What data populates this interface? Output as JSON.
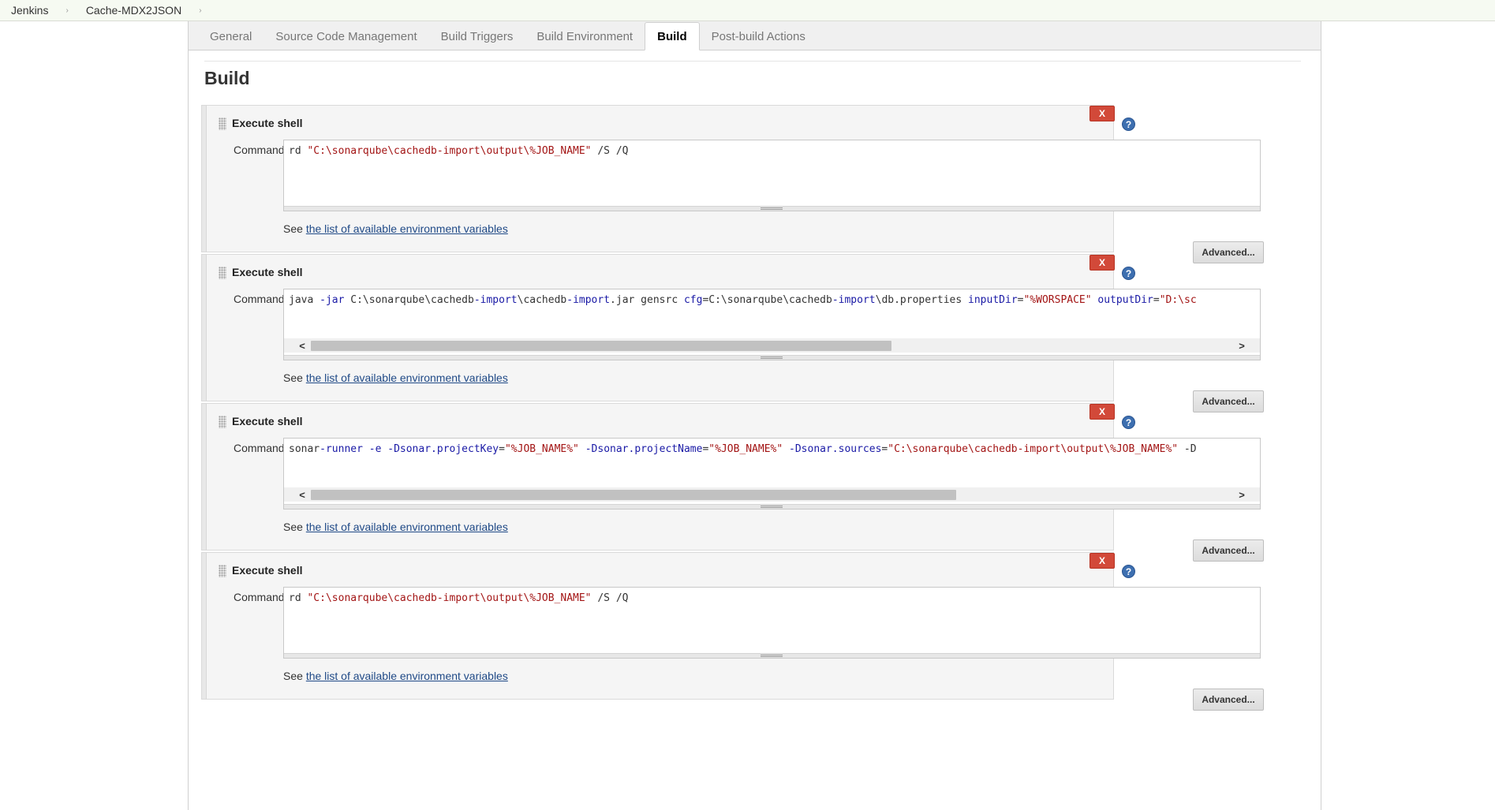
{
  "breadcrumb": {
    "items": [
      "Jenkins",
      "Cache-MDX2JSON"
    ],
    "separator": "›"
  },
  "tabs": [
    {
      "label": "General",
      "active": false
    },
    {
      "label": "Source Code Management",
      "active": false
    },
    {
      "label": "Build Triggers",
      "active": false
    },
    {
      "label": "Build Environment",
      "active": false
    },
    {
      "label": "Build",
      "active": true
    },
    {
      "label": "Post-build Actions",
      "active": false
    }
  ],
  "section_title": "Build",
  "steps": [
    {
      "title": "Execute shell",
      "command_label": "Command",
      "command": "rd \"C:\\sonarqube\\cachedb-import\\output\\%JOB_NAME\" /S /Q",
      "see_prefix": "See ",
      "env_link": "the list of available environment variables",
      "delete_label": "X",
      "help_label": "?",
      "advanced_label": "Advanced...",
      "hscroll_fraction": 0
    },
    {
      "title": "Execute shell",
      "command_label": "Command",
      "command": "java -jar C:\\sonarqube\\cachedb-import\\cachedb-import.jar gensrc cfg=C:\\sonarqube\\cachedb-import\\db.properties inputDir=\"%WORSPACE\" outputDir=\"D:\\sc",
      "see_prefix": "See ",
      "env_link": "the list of available environment variables",
      "delete_label": "X",
      "help_label": "?",
      "advanced_label": "Advanced...",
      "hscroll_fraction": 0.63
    },
    {
      "title": "Execute shell",
      "command_label": "Command",
      "command": "sonar-runner -e -Dsonar.projectKey=\"%JOB_NAME%\" -Dsonar.projectName=\"%JOB_NAME%\" -Dsonar.sources=\"C:\\sonarqube\\cachedb-import\\output\\%JOB_NAME%\" -D",
      "see_prefix": "See ",
      "env_link": "the list of available environment variables",
      "delete_label": "X",
      "help_label": "?",
      "advanced_label": "Advanced...",
      "hscroll_fraction": 0.7
    },
    {
      "title": "Execute shell",
      "command_label": "Command",
      "command": "rd \"C:\\sonarqube\\cachedb-import\\output\\%JOB_NAME\" /S /Q",
      "see_prefix": "See ",
      "env_link": "the list of available environment variables",
      "delete_label": "X",
      "help_label": "?",
      "advanced_label": "Advanced...",
      "hscroll_fraction": 0
    }
  ],
  "colors": {
    "delete_button": "#d24939",
    "help_icon": "#3d6fb0",
    "link": "#204a87",
    "string_literal": "#a31515",
    "keyword": "#1a1aa6"
  },
  "icons": {
    "help": "help-icon",
    "delete": "delete-icon",
    "drag_handle": "drag-handle-icon"
  }
}
